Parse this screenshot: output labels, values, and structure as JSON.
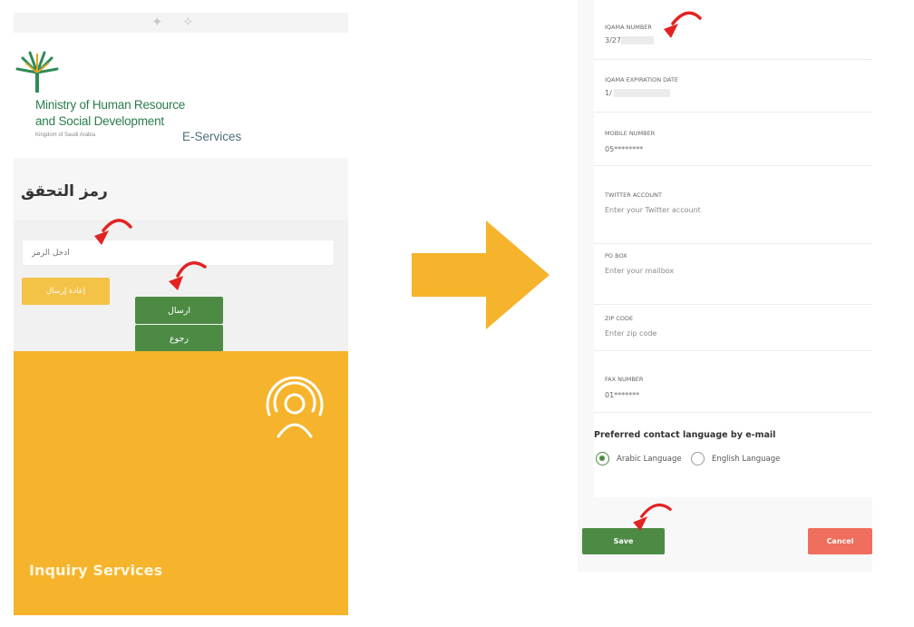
{
  "colors": {
    "ministry_green": "#2b7c4c",
    "button_green": "#4d8b45",
    "resend_yellow": "#f4c247",
    "inquiry_orange": "#f6b42c",
    "cancel_red": "#ef6e5d",
    "arrow_yellow": "#f6b42c",
    "pointer_red": "#e32222"
  },
  "left": {
    "ministry_line1": "Ministry of Human Resource",
    "ministry_line2": "and Social Development",
    "kingdom": "Kingdom of Saudi Arabia",
    "eservices": "E-Services",
    "verification_title": "رمز التحقق",
    "code_placeholder": "أدخل الرمز",
    "resend_label": "إعادة إرسال",
    "send_label": "ارسال",
    "back_label": "رجوع",
    "inquiry_label": "Inquiry Services",
    "inquiry_icon": "support-agent-icon",
    "logo_icon": "palm-tree-logo"
  },
  "right": {
    "fields": [
      {
        "label": "IQAMA NUMBER",
        "value": "3/27"
      },
      {
        "label": "IQAMA EXPIRATION DATE",
        "value": "1/"
      },
      {
        "label": "MOBILE NUMBER",
        "value": "05********"
      },
      {
        "label": "TWITTER ACCOUNT",
        "placeholder": "Enter your Twitter account"
      },
      {
        "label": "PO BOX",
        "placeholder": "Enter your mailbox"
      },
      {
        "label": "ZIP CODE",
        "placeholder": "Enter zip code"
      },
      {
        "label": "FAX NUMBER",
        "value": "01*******"
      }
    ],
    "pref_title": "Preferred contact language by e-mail",
    "languages": [
      {
        "label": "Arabic Language",
        "selected": true
      },
      {
        "label": "English Language",
        "selected": false
      }
    ],
    "save_label": "Save",
    "cancel_label": "Cancel"
  }
}
